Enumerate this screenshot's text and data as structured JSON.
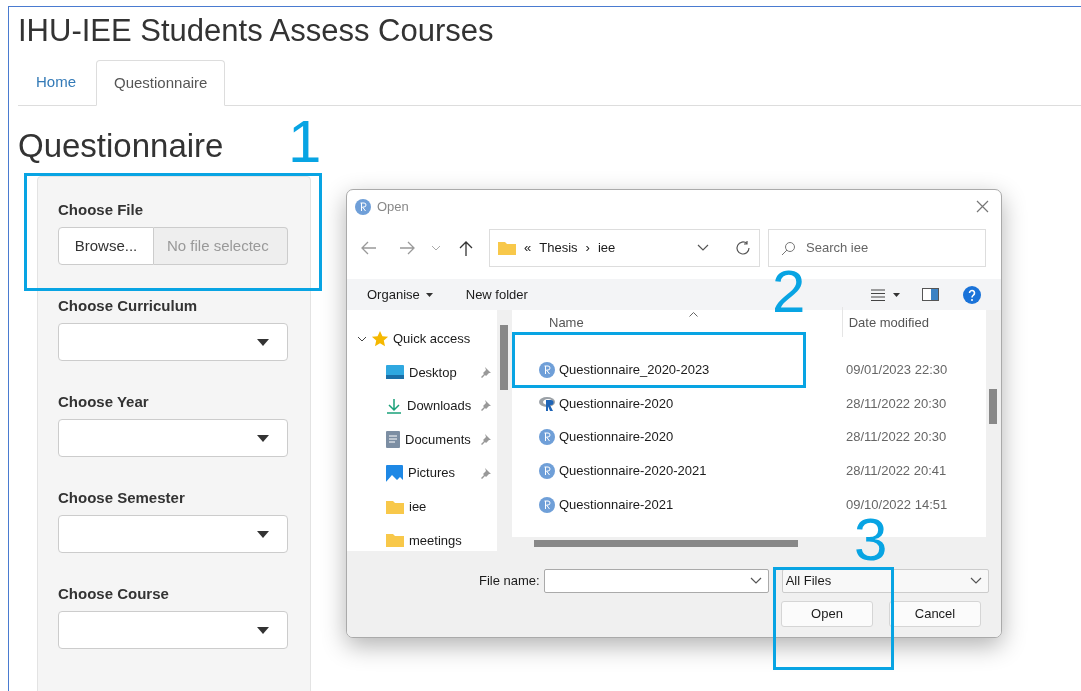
{
  "app": {
    "title": "IHU-IEE Students Assess Courses"
  },
  "tabs": [
    {
      "label": "Home",
      "selected": false
    },
    {
      "label": "Questionnaire",
      "selected": true
    }
  ],
  "heading": "Questionnaire",
  "file_input": {
    "label": "Choose File",
    "button": "Browse...",
    "placeholder": "No file selectec"
  },
  "selects": [
    {
      "label": "Choose Curriculum"
    },
    {
      "label": "Choose Year"
    },
    {
      "label": "Choose Semester"
    },
    {
      "label": "Choose Course"
    }
  ],
  "dialog": {
    "title": "Open",
    "breadcrumb": [
      "«",
      "Thesis",
      "›",
      "iee"
    ],
    "search": {
      "placeholder": "Search iee"
    },
    "toolbar": [
      "Organise",
      "New folder"
    ],
    "nav": [
      {
        "label": "Quick access",
        "kind": "star",
        "expanded": true,
        "pinned": false
      },
      {
        "label": "Desktop",
        "kind": "desktop",
        "pinned": true
      },
      {
        "label": "Downloads",
        "kind": "download",
        "pinned": true
      },
      {
        "label": "Documents",
        "kind": "document",
        "pinned": true
      },
      {
        "label": "Pictures",
        "kind": "picture",
        "pinned": true
      },
      {
        "label": "iee",
        "kind": "folder",
        "pinned": false
      },
      {
        "label": "meetings",
        "kind": "folder",
        "pinned": false
      }
    ],
    "columns": [
      "Name",
      "Date modified"
    ],
    "files": [
      {
        "name": "Questionnaire_2020-2023",
        "date": "09/01/2023 22:30",
        "kind": "r-doc"
      },
      {
        "name": "Questionnaire-2020",
        "date": "28/11/2022 20:30",
        "kind": "r-app"
      },
      {
        "name": "Questionnaire-2020",
        "date": "28/11/2022 20:30",
        "kind": "r-doc"
      },
      {
        "name": "Questionnaire-2020-2021",
        "date": "28/11/2022 20:41",
        "kind": "r-doc"
      },
      {
        "name": "Questionnaire-2021",
        "date": "09/10/2022 14:51",
        "kind": "r-doc"
      }
    ],
    "file_name_label": "File name:",
    "filter": "All Files",
    "buttons": [
      "Open",
      "Cancel"
    ]
  },
  "annotations": [
    {
      "label": "1"
    },
    {
      "label": "2"
    },
    {
      "label": "3"
    }
  ]
}
